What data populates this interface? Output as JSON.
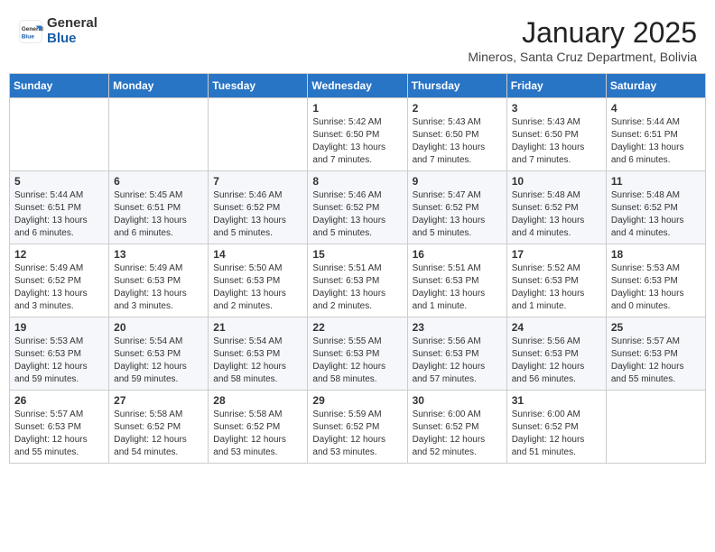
{
  "logo": {
    "general": "General",
    "blue": "Blue"
  },
  "header": {
    "month": "January 2025",
    "location": "Mineros, Santa Cruz Department, Bolivia"
  },
  "weekdays": [
    "Sunday",
    "Monday",
    "Tuesday",
    "Wednesday",
    "Thursday",
    "Friday",
    "Saturday"
  ],
  "weeks": [
    [
      {
        "day": null,
        "info": null
      },
      {
        "day": null,
        "info": null
      },
      {
        "day": null,
        "info": null
      },
      {
        "day": "1",
        "info": "Sunrise: 5:42 AM\nSunset: 6:50 PM\nDaylight: 13 hours\nand 7 minutes."
      },
      {
        "day": "2",
        "info": "Sunrise: 5:43 AM\nSunset: 6:50 PM\nDaylight: 13 hours\nand 7 minutes."
      },
      {
        "day": "3",
        "info": "Sunrise: 5:43 AM\nSunset: 6:50 PM\nDaylight: 13 hours\nand 7 minutes."
      },
      {
        "day": "4",
        "info": "Sunrise: 5:44 AM\nSunset: 6:51 PM\nDaylight: 13 hours\nand 6 minutes."
      }
    ],
    [
      {
        "day": "5",
        "info": "Sunrise: 5:44 AM\nSunset: 6:51 PM\nDaylight: 13 hours\nand 6 minutes."
      },
      {
        "day": "6",
        "info": "Sunrise: 5:45 AM\nSunset: 6:51 PM\nDaylight: 13 hours\nand 6 minutes."
      },
      {
        "day": "7",
        "info": "Sunrise: 5:46 AM\nSunset: 6:52 PM\nDaylight: 13 hours\nand 5 minutes."
      },
      {
        "day": "8",
        "info": "Sunrise: 5:46 AM\nSunset: 6:52 PM\nDaylight: 13 hours\nand 5 minutes."
      },
      {
        "day": "9",
        "info": "Sunrise: 5:47 AM\nSunset: 6:52 PM\nDaylight: 13 hours\nand 5 minutes."
      },
      {
        "day": "10",
        "info": "Sunrise: 5:48 AM\nSunset: 6:52 PM\nDaylight: 13 hours\nand 4 minutes."
      },
      {
        "day": "11",
        "info": "Sunrise: 5:48 AM\nSunset: 6:52 PM\nDaylight: 13 hours\nand 4 minutes."
      }
    ],
    [
      {
        "day": "12",
        "info": "Sunrise: 5:49 AM\nSunset: 6:52 PM\nDaylight: 13 hours\nand 3 minutes."
      },
      {
        "day": "13",
        "info": "Sunrise: 5:49 AM\nSunset: 6:53 PM\nDaylight: 13 hours\nand 3 minutes."
      },
      {
        "day": "14",
        "info": "Sunrise: 5:50 AM\nSunset: 6:53 PM\nDaylight: 13 hours\nand 2 minutes."
      },
      {
        "day": "15",
        "info": "Sunrise: 5:51 AM\nSunset: 6:53 PM\nDaylight: 13 hours\nand 2 minutes."
      },
      {
        "day": "16",
        "info": "Sunrise: 5:51 AM\nSunset: 6:53 PM\nDaylight: 13 hours\nand 1 minute."
      },
      {
        "day": "17",
        "info": "Sunrise: 5:52 AM\nSunset: 6:53 PM\nDaylight: 13 hours\nand 1 minute."
      },
      {
        "day": "18",
        "info": "Sunrise: 5:53 AM\nSunset: 6:53 PM\nDaylight: 13 hours\nand 0 minutes."
      }
    ],
    [
      {
        "day": "19",
        "info": "Sunrise: 5:53 AM\nSunset: 6:53 PM\nDaylight: 12 hours\nand 59 minutes."
      },
      {
        "day": "20",
        "info": "Sunrise: 5:54 AM\nSunset: 6:53 PM\nDaylight: 12 hours\nand 59 minutes."
      },
      {
        "day": "21",
        "info": "Sunrise: 5:54 AM\nSunset: 6:53 PM\nDaylight: 12 hours\nand 58 minutes."
      },
      {
        "day": "22",
        "info": "Sunrise: 5:55 AM\nSunset: 6:53 PM\nDaylight: 12 hours\nand 58 minutes."
      },
      {
        "day": "23",
        "info": "Sunrise: 5:56 AM\nSunset: 6:53 PM\nDaylight: 12 hours\nand 57 minutes."
      },
      {
        "day": "24",
        "info": "Sunrise: 5:56 AM\nSunset: 6:53 PM\nDaylight: 12 hours\nand 56 minutes."
      },
      {
        "day": "25",
        "info": "Sunrise: 5:57 AM\nSunset: 6:53 PM\nDaylight: 12 hours\nand 55 minutes."
      }
    ],
    [
      {
        "day": "26",
        "info": "Sunrise: 5:57 AM\nSunset: 6:53 PM\nDaylight: 12 hours\nand 55 minutes."
      },
      {
        "day": "27",
        "info": "Sunrise: 5:58 AM\nSunset: 6:52 PM\nDaylight: 12 hours\nand 54 minutes."
      },
      {
        "day": "28",
        "info": "Sunrise: 5:58 AM\nSunset: 6:52 PM\nDaylight: 12 hours\nand 53 minutes."
      },
      {
        "day": "29",
        "info": "Sunrise: 5:59 AM\nSunset: 6:52 PM\nDaylight: 12 hours\nand 53 minutes."
      },
      {
        "day": "30",
        "info": "Sunrise: 6:00 AM\nSunset: 6:52 PM\nDaylight: 12 hours\nand 52 minutes."
      },
      {
        "day": "31",
        "info": "Sunrise: 6:00 AM\nSunset: 6:52 PM\nDaylight: 12 hours\nand 51 minutes."
      },
      {
        "day": null,
        "info": null
      }
    ]
  ]
}
